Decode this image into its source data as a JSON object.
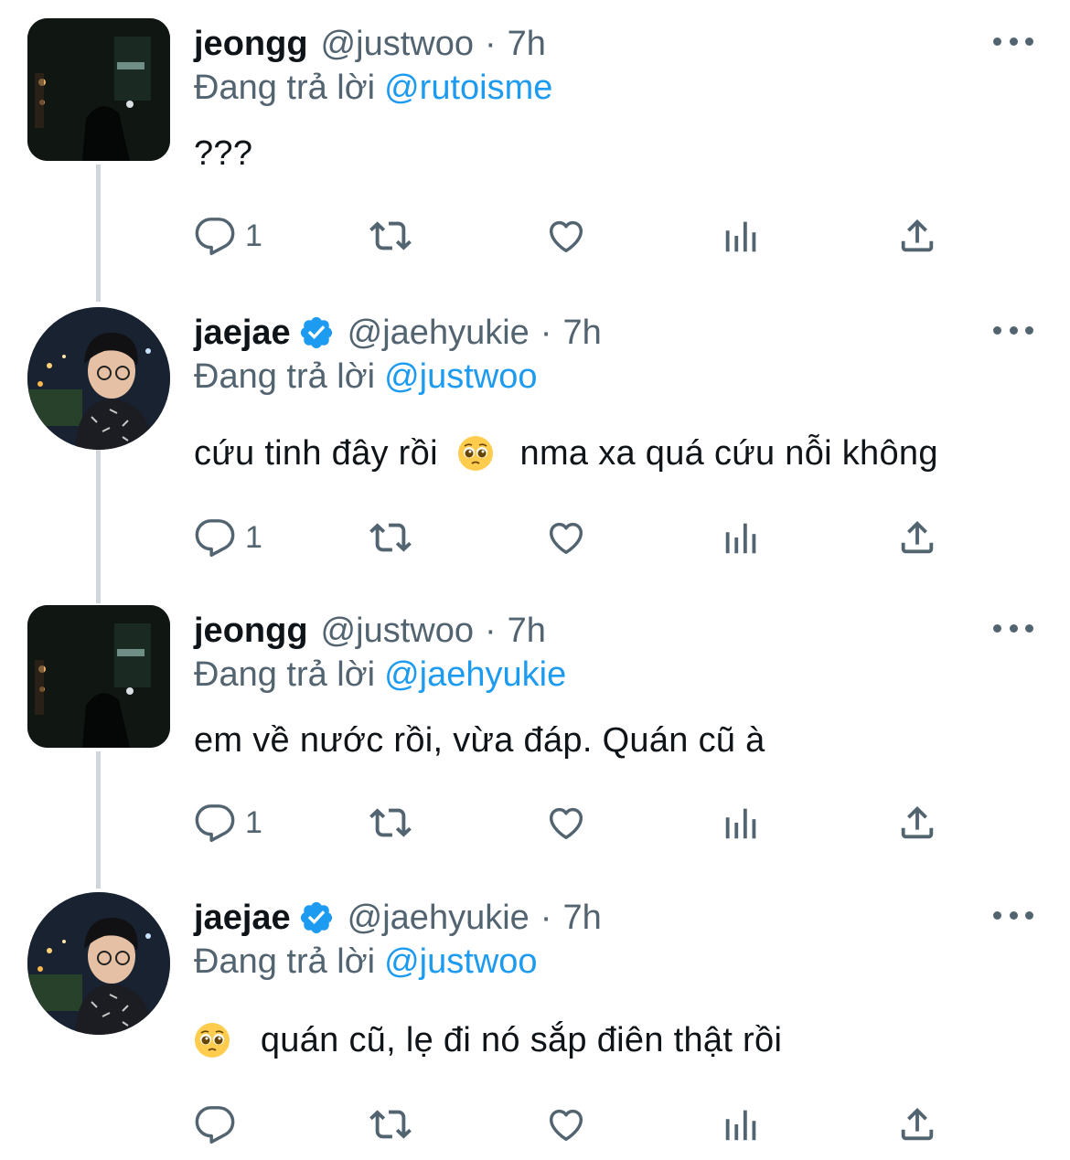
{
  "tweets": [
    {
      "name": "jeongg",
      "handle": "@justwoo",
      "dot": "·",
      "time": "7h",
      "verified": false,
      "reply_prefix": "Đang trả lời",
      "reply_to": "@rutoisme",
      "text_before": "???",
      "text_after": "",
      "reply_count": "1"
    },
    {
      "name": "jaejae",
      "handle": "@jaehyukie",
      "dot": "·",
      "time": "7h",
      "verified": true,
      "reply_prefix": "Đang trả lời",
      "reply_to": "@justwoo",
      "text_before": "cứu tinh đây rồi",
      "text_after": "nma xa quá cứu nỗi không",
      "reply_count": "1"
    },
    {
      "name": "jeongg",
      "handle": "@justwoo",
      "dot": "·",
      "time": "7h",
      "verified": false,
      "reply_prefix": "Đang trả lời",
      "reply_to": "@jaehyukie",
      "text_before": "em về nước rồi, vừa đáp. Quán cũ à",
      "text_after": "",
      "reply_count": "1"
    },
    {
      "name": "jaejae",
      "handle": "@jaehyukie",
      "dot": "·",
      "time": "7h",
      "verified": true,
      "reply_prefix": "Đang trả lời",
      "reply_to": "@justwoo",
      "text_before": "",
      "text_after": "quán cũ, lẹ đi nó sắp điên thật rồi",
      "reply_count": ""
    }
  ],
  "icons": {
    "reply": "reply-icon",
    "retweet": "retweet-icon",
    "like": "heart-icon",
    "views": "analytics-icon",
    "share": "share-icon",
    "more": "more-icon",
    "verified": "verified-badge-icon",
    "emoji": "pleading-face-emoji"
  },
  "colors": {
    "text": "#0f1419",
    "secondary": "#536471",
    "link": "#1d9bf0",
    "thread_line": "#d0d6dc"
  }
}
